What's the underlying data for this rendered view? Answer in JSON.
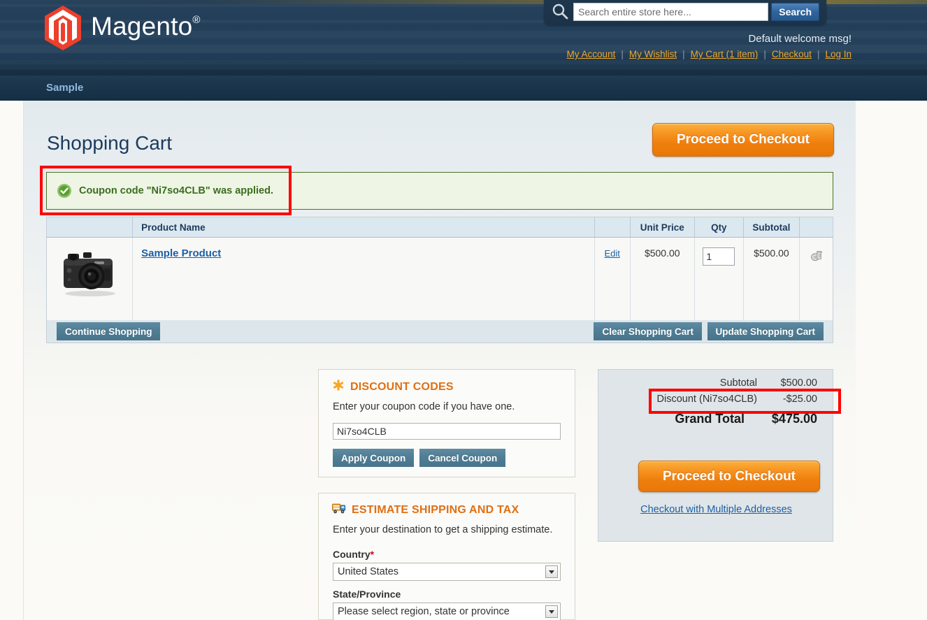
{
  "header": {
    "logo_text": "Magento",
    "logo_registered": "®",
    "search": {
      "placeholder": "Search entire store here...",
      "value": "",
      "button_label": "Search",
      "icon": "search-icon"
    },
    "welcome_message": "Default welcome msg!",
    "links": [
      {
        "label": "My Account"
      },
      {
        "label": "My Wishlist"
      },
      {
        "label": "My Cart (1 item)"
      },
      {
        "label": "Checkout"
      },
      {
        "label": "Log In"
      }
    ],
    "separator": "|"
  },
  "nav": {
    "items": [
      {
        "label": "Sample"
      }
    ]
  },
  "main": {
    "page_title": "Shopping Cart",
    "checkout_top_label": "Proceed to Checkout",
    "success_message": {
      "icon": "success-check-icon",
      "text": "Coupon code \"Ni7so4CLB\" was applied."
    },
    "cart_table": {
      "columns": [
        "",
        "Product Name",
        "",
        "Unit Price",
        "Qty",
        "Subtotal",
        ""
      ],
      "rows": [
        {
          "image": "camera-thumbnail",
          "product_name": "Sample Product",
          "edit_label": "Edit",
          "unit_price": "$500.00",
          "qty": "1",
          "subtotal": "$500.00",
          "remove_icon": "trash-icon"
        }
      ]
    },
    "cart_footer": {
      "continue_shopping": "Continue Shopping",
      "clear_cart": "Clear Shopping Cart",
      "update_cart": "Update Shopping Cart"
    }
  },
  "discount": {
    "icon": "asterisk-icon",
    "title": "DISCOUNT CODES",
    "subtitle": "Enter your coupon code if you have one.",
    "input_value": "Ni7so4CLB",
    "input_placeholder": "",
    "apply_label": "Apply Coupon",
    "cancel_label": "Cancel Coupon"
  },
  "shipping": {
    "icon": "truck-icon",
    "title": "ESTIMATE SHIPPING AND TAX",
    "subtitle": "Enter your destination to get a shipping estimate.",
    "country_label": "Country",
    "country_required": "*",
    "country_value": "United States",
    "state_label": "State/Province",
    "state_value": "Please select region, state or province"
  },
  "totals": {
    "subtotal_label": "Subtotal",
    "subtotal_value": "$500.00",
    "discount_label": "Discount (Ni7so4CLB)",
    "discount_value": "-$25.00",
    "grand_total_label": "Grand Total",
    "grand_total_value": "$475.00",
    "checkout_label": "Proceed to Checkout",
    "multiple_addresses_label": "Checkout with Multiple Addresses"
  },
  "annotations": {
    "highlight_color": "#ff0000",
    "boxes": [
      "success-message-highlight",
      "discount-row-highlight"
    ]
  },
  "colors": {
    "header_bg": "#223e58",
    "nav_bg": "#16324a",
    "accent_orange": "#e06f12",
    "link_orange": "#f0a828",
    "link_blue": "#1b5fa8",
    "button_slate": "#4f7e95",
    "success_green": "#3c6d1f",
    "success_bg": "#eef5e4"
  }
}
